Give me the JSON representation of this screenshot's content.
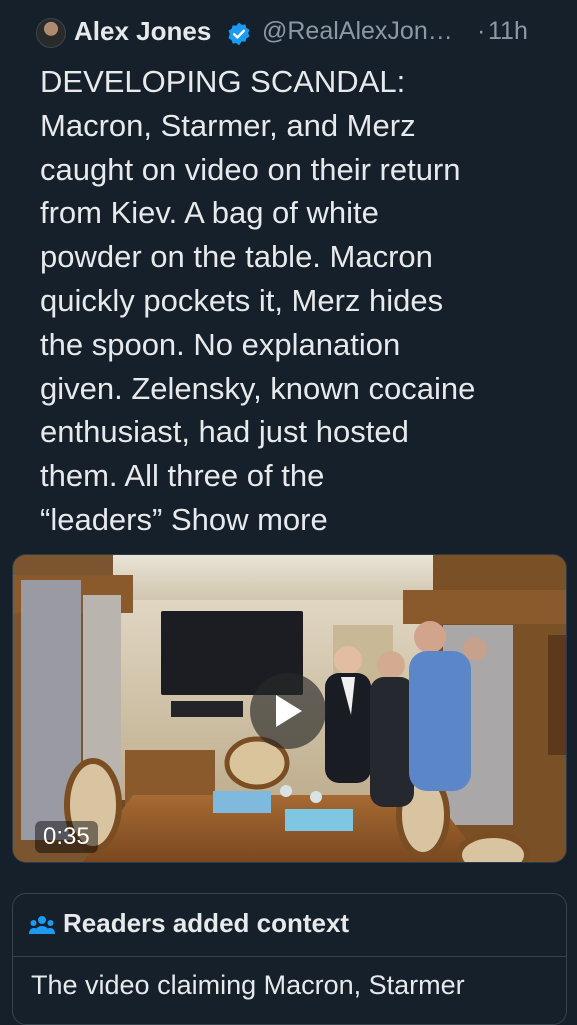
{
  "tweet": {
    "author_name": "Alex Jones",
    "handle": "@RealAlexJon…",
    "separator": "·",
    "time": "11h",
    "text": "DEVELOPING SCANDAL:\nMacron, Starmer, and Merz\ncaught on video on their return\nfrom Kiev. A bag of white\npowder on the table. Macron\nquickly pockets it, Merz hides\nthe spoon. No explanation\ngiven. Zelensky, known cocaine\nenthusiast, had just hosted\nthem. All three of the\n“leaders” ",
    "show_more": "Show more"
  },
  "media": {
    "duration": "0:35"
  },
  "context": {
    "title": "Readers added context",
    "body": "The video claiming Macron, Starmer"
  },
  "colors": {
    "background": "#15202b",
    "text": "#e7e9ea",
    "secondary": "#8b98a5",
    "verified": "#1d9bf0",
    "border": "#38444d"
  },
  "icons": {
    "avatar": "avatar",
    "verified": "verified-badge-icon",
    "play": "play-icon",
    "context": "people-icon"
  }
}
